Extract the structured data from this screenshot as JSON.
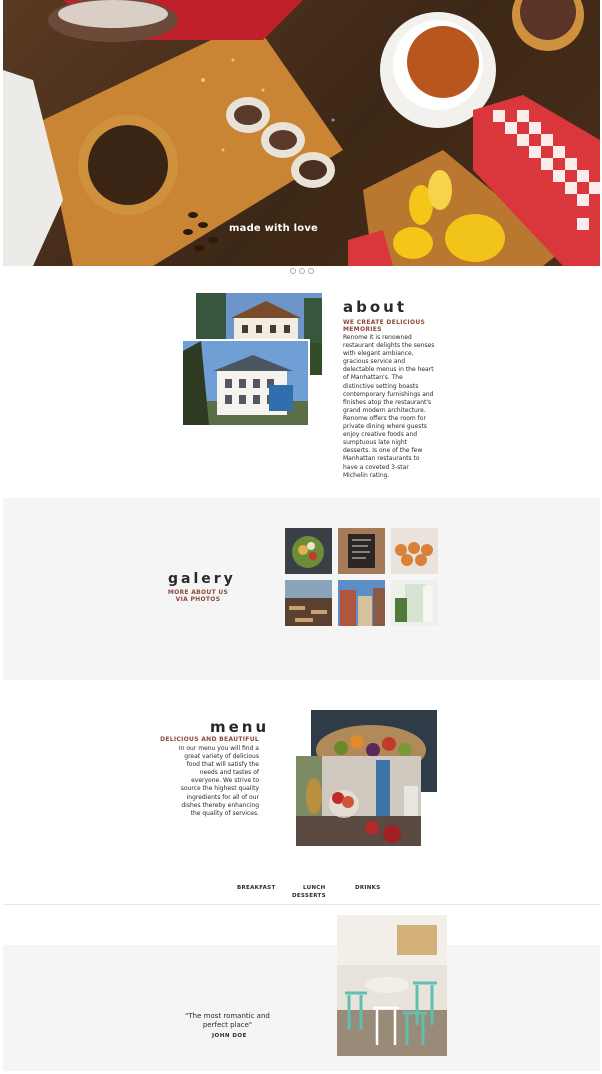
{
  "hero": {
    "caption": "made with love",
    "subcaption": "",
    "slides": 3,
    "active_slide": 1
  },
  "about": {
    "title": "about",
    "subtitle": "WE CREATE DELICIOUS MEMORIES",
    "body": "Renome it is renowned restaurant delights the senses with elegant ambiance, gracious service and delectable menus in the heart of Manhattan's. The distinctive setting boasts contemporary furnishings and finishes atop the restaurant's grand modern architecture. Renome offers the room for private dining where guests enjoy creative foods and sumptuous late night desserts. Is one of the few Manhattan restaurants to have a coveted 3-star Michelin rating."
  },
  "gallery": {
    "title": "galery",
    "subtitle": "MORE ABOUT US VIA PHOTOS",
    "thumbnails": [
      "salad-bowl",
      "chalkboard-menu",
      "baked-buns",
      "terrace-tables",
      "old-town-street",
      "window-curtain"
    ]
  },
  "menu": {
    "title": "menu",
    "subtitle": "DELICIOUS AND BEAUTIFUL",
    "body": "In our menu you will find a great variety of delicious food that will satisfy the needs and tastes of everyone. We strive to source the highest quality ingredients for all of our dishes thereby enhancing the quality of services.",
    "tabs": [
      {
        "label": "BREAKFAST"
      },
      {
        "label": "LUNCH"
      },
      {
        "label": "DRINKS"
      },
      {
        "label": "DESSERTS"
      }
    ]
  },
  "testimonial": {
    "quote": "\"The most romantic and perfect place\"",
    "author": "JOHN DOE"
  },
  "colors": {
    "accent": "#8b4a3a",
    "band": "#f5f5f5",
    "text": "#2a2a2a"
  }
}
